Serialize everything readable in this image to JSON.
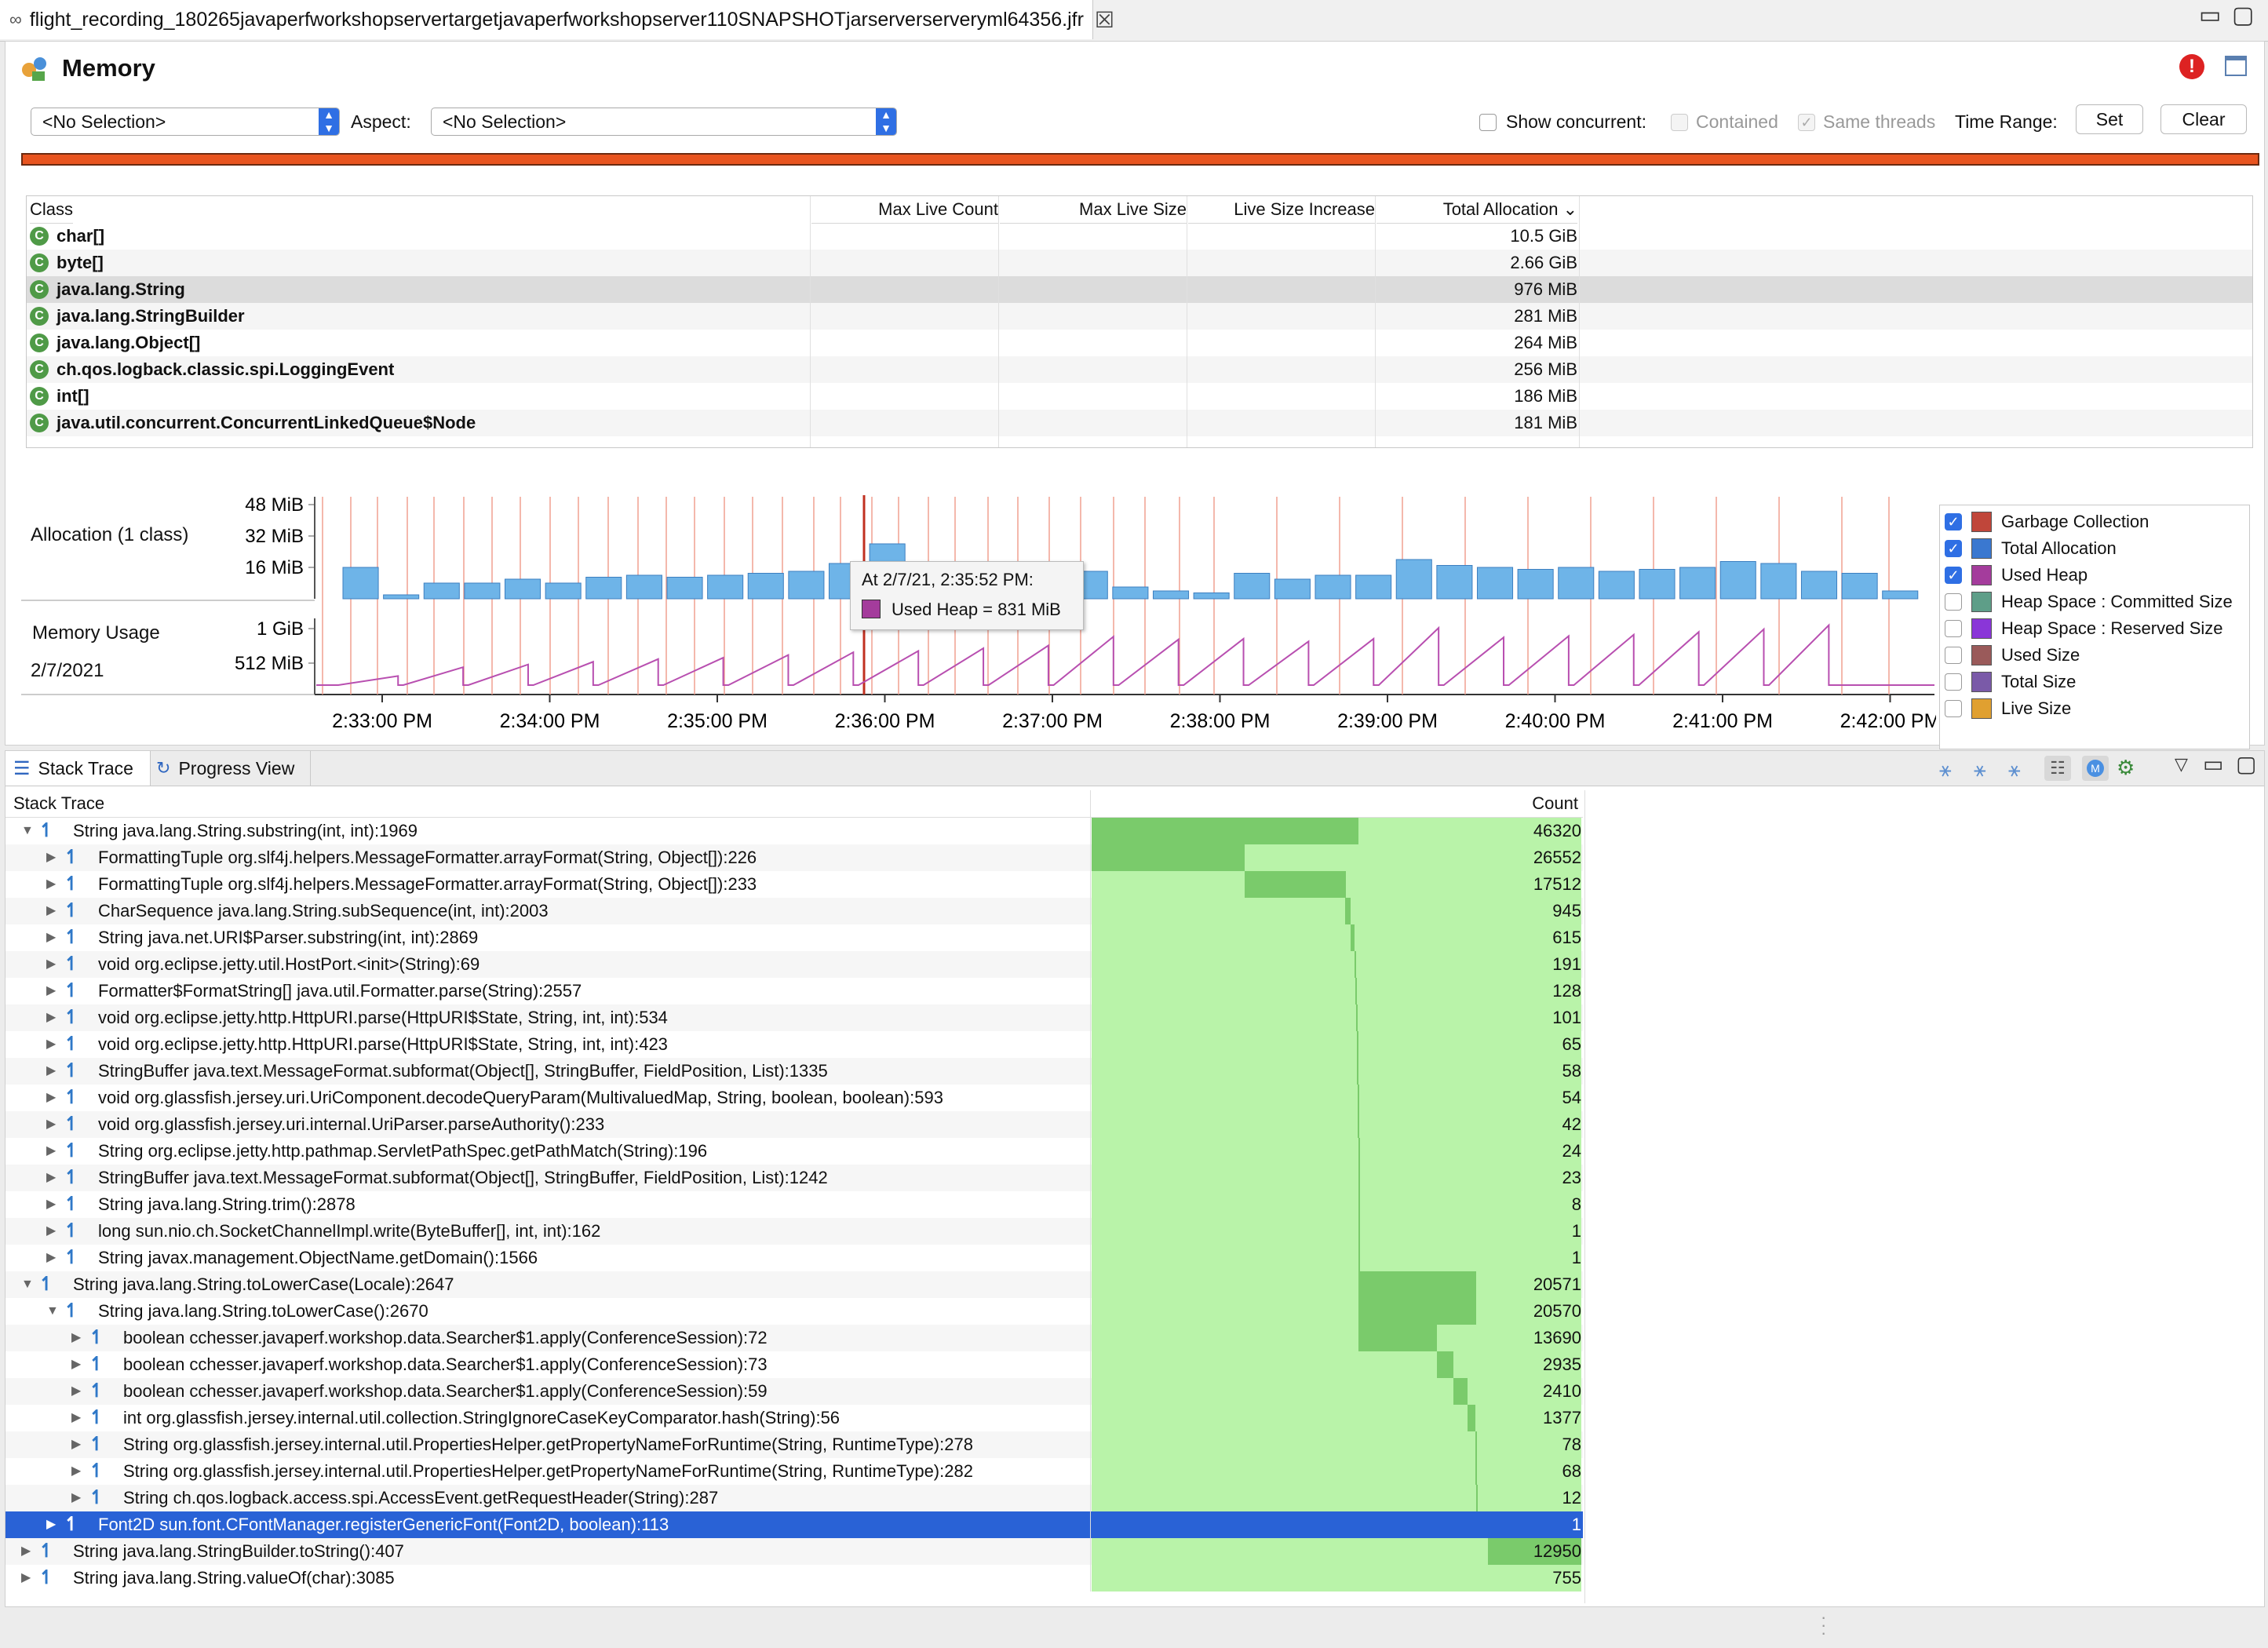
{
  "window": {
    "tab_title": "flight_recording_180265javaperfworkshopservertargetjavaperfworkshopserver110SNAPSHOTjarserverserveryml64356.jfr",
    "tab_icon": "recording-icon",
    "close_glyph": "☒",
    "minimize_glyph": "▭",
    "maximize_glyph": "▢"
  },
  "memory": {
    "title": "Memory",
    "warning_glyph": "!",
    "filter_select": "<No Selection>",
    "aspect_label": "Aspect:",
    "aspect_select": "<No Selection>",
    "show_concurrent_label": "Show concurrent:",
    "contained_label": "Contained",
    "same_threads_label": "Same threads",
    "time_range_label": "Time Range:",
    "set_label": "Set",
    "clear_label": "Clear",
    "progress_color": "#e8541f"
  },
  "class_table": {
    "columns": {
      "class": "Class",
      "max_live_count": "Max Live Count",
      "max_live_size": "Max Live Size",
      "live_size_increase": "Live Size Increase",
      "total_allocation": "Total Allocation"
    },
    "rows": [
      {
        "icon": "C",
        "name": "char[]",
        "total": "10.5 GiB"
      },
      {
        "icon": "C",
        "name": "byte[]",
        "total": "2.66 GiB"
      },
      {
        "icon": "C",
        "name": "java.lang.String",
        "total": "976 MiB"
      },
      {
        "icon": "C",
        "name": "java.lang.StringBuilder",
        "total": "281 MiB"
      },
      {
        "icon": "C",
        "name": "java.lang.Object[]",
        "total": "264 MiB"
      },
      {
        "icon": "C",
        "name": "ch.qos.logback.classic.spi.LoggingEvent",
        "total": "256 MiB"
      },
      {
        "icon": "C",
        "name": "int[]",
        "total": "186 MiB"
      },
      {
        "icon": "C",
        "name": "java.util.concurrent.ConcurrentLinkedQueue$Node",
        "total": "181 MiB"
      }
    ]
  },
  "chart": {
    "alloc_label": "Allocation (1 class)",
    "usage_label": "Memory Usage",
    "date_label": "2/7/2021",
    "alloc_ticks": [
      "48 MiB",
      "32 MiB",
      "16 MiB"
    ],
    "usage_ticks": [
      "1 GiB",
      "512 MiB"
    ],
    "time_ticks": [
      "2:33:00 PM",
      "2:34:00 PM",
      "2:35:00 PM",
      "2:36:00 PM",
      "2:37:00 PM",
      "2:38:00 PM",
      "2:39:00 PM",
      "2:40:00 PM",
      "2:41:00 PM",
      "2:42:00 PM"
    ],
    "tooltip_title": "At 2/7/21, 2:35:52 PM:",
    "tooltip_value": "Used Heap = 831 MiB",
    "bar_color": "#6eb4e8",
    "heap_color": "#b84fb0"
  },
  "chart_data": {
    "type": "bar",
    "alloc_mib": [
      16,
      2,
      8,
      8,
      10,
      8,
      11,
      12,
      11,
      12,
      13,
      14,
      18,
      28,
      14,
      14,
      16,
      13,
      14,
      6,
      4,
      3,
      13,
      10,
      12,
      12,
      20,
      17,
      16,
      15,
      16,
      14,
      15,
      16,
      19,
      18,
      14,
      13,
      4
    ],
    "used_heap_sawtooth_peaks_mib": [
      250,
      380,
      420,
      460,
      500,
      520,
      560,
      600,
      620,
      660,
      700,
      831,
      790,
      800,
      760,
      800,
      960,
      820,
      840,
      860,
      900,
      940,
      1000
    ]
  },
  "legend": [
    {
      "label": "Garbage Collection",
      "checked": true,
      "color": "#c0463a"
    },
    {
      "label": "Total Allocation",
      "checked": true,
      "color": "#3a78d0"
    },
    {
      "label": "Used Heap",
      "checked": true,
      "color": "#a43c9c"
    },
    {
      "label": "Heap Space : Committed Size",
      "checked": false,
      "color": "#5e9e88"
    },
    {
      "label": "Heap Space : Reserved Size",
      "checked": false,
      "color": "#8a36d8"
    },
    {
      "label": "Used Size",
      "checked": false,
      "color": "#9a5a5a"
    },
    {
      "label": "Total Size",
      "checked": false,
      "color": "#7a5aa8"
    },
    {
      "label": "Live Size",
      "checked": false,
      "color": "#e0a030"
    }
  ],
  "bottom_tabs": {
    "stack_trace": "Stack Trace",
    "progress_view": "Progress View"
  },
  "stack_table": {
    "col_stack": "Stack Trace",
    "col_count": "Count",
    "rows": [
      {
        "level": 0,
        "open": true,
        "text": "String java.lang.String.substring(int, int):1969",
        "count": "46320",
        "b": 0,
        "d": 46320
      },
      {
        "level": 1,
        "open": false,
        "text": "FormattingTuple org.slf4j.helpers.MessageFormatter.arrayFormat(String, Object[]):226",
        "count": "26552",
        "b": 0,
        "d": 26552
      },
      {
        "level": 1,
        "open": false,
        "text": "FormattingTuple org.slf4j.helpers.MessageFormatter.arrayFormat(String, Object[]):233",
        "count": "17512",
        "b": 26552,
        "d": 17512
      },
      {
        "level": 1,
        "open": false,
        "text": "CharSequence java.lang.String.subSequence(int, int):2003",
        "count": "945",
        "b": 44064,
        "d": 945
      },
      {
        "level": 1,
        "open": false,
        "text": "String java.net.URI$Parser.substring(int, int):2869",
        "count": "615",
        "b": 45009,
        "d": 615
      },
      {
        "level": 1,
        "open": false,
        "text": "void org.eclipse.jetty.util.HostPort.<init>(String):69",
        "count": "191",
        "b": 45624,
        "d": 191
      },
      {
        "level": 1,
        "open": false,
        "text": "Formatter$FormatString[] java.util.Formatter.parse(String):2557",
        "count": "128",
        "b": 45815,
        "d": 128
      },
      {
        "level": 1,
        "open": false,
        "text": "void org.eclipse.jetty.http.HttpURI.parse(HttpURI$State, String, int, int):534",
        "count": "101",
        "b": 45943,
        "d": 101
      },
      {
        "level": 1,
        "open": false,
        "text": "void org.eclipse.jetty.http.HttpURI.parse(HttpURI$State, String, int, int):423",
        "count": "65",
        "b": 46044,
        "d": 65
      },
      {
        "level": 1,
        "open": false,
        "text": "StringBuffer java.text.MessageFormat.subformat(Object[], StringBuffer, FieldPosition, List):1335",
        "count": "58",
        "b": 46109,
        "d": 58
      },
      {
        "level": 1,
        "open": false,
        "text": "void org.glassfish.jersey.uri.UriComponent.decodeQueryParam(MultivaluedMap, String, boolean, boolean):593",
        "count": "54",
        "b": 46167,
        "d": 54
      },
      {
        "level": 1,
        "open": false,
        "text": "void org.glassfish.jersey.uri.internal.UriParser.parseAuthority():233",
        "count": "42",
        "b": 46221,
        "d": 42
      },
      {
        "level": 1,
        "open": false,
        "text": "String org.eclipse.jetty.http.pathmap.ServletPathSpec.getPathMatch(String):196",
        "count": "24",
        "b": 46263,
        "d": 24
      },
      {
        "level": 1,
        "open": false,
        "text": "StringBuffer java.text.MessageFormat.subformat(Object[], StringBuffer, FieldPosition, List):1242",
        "count": "23",
        "b": 46287,
        "d": 23
      },
      {
        "level": 1,
        "open": false,
        "text": "String java.lang.String.trim():2878",
        "count": "8",
        "b": 46310,
        "d": 8
      },
      {
        "level": 1,
        "open": false,
        "text": "long sun.nio.ch.SocketChannelImpl.write(ByteBuffer[], int, int):162",
        "count": "1",
        "b": 46318,
        "d": 1
      },
      {
        "level": 1,
        "open": false,
        "text": "String javax.management.ObjectName.getDomain():1566",
        "count": "1",
        "b": 46319,
        "d": 1
      },
      {
        "level": 0,
        "open": true,
        "text": "String java.lang.String.toLowerCase(Locale):2647",
        "count": "20571",
        "b": 46320,
        "d": 20571
      },
      {
        "level": 1,
        "open": true,
        "text": "String java.lang.String.toLowerCase():2670",
        "count": "20570",
        "b": 46320,
        "d": 20570
      },
      {
        "level": 2,
        "open": false,
        "text": "boolean cchesser.javaperf.workshop.data.Searcher$1.apply(ConferenceSession):72",
        "count": "13690",
        "b": 46320,
        "d": 13690
      },
      {
        "level": 2,
        "open": false,
        "text": "boolean cchesser.javaperf.workshop.data.Searcher$1.apply(ConferenceSession):73",
        "count": "2935",
        "b": 60010,
        "d": 2935
      },
      {
        "level": 2,
        "open": false,
        "text": "boolean cchesser.javaperf.workshop.data.Searcher$1.apply(ConferenceSession):59",
        "count": "2410",
        "b": 62945,
        "d": 2410
      },
      {
        "level": 2,
        "open": false,
        "text": "int org.glassfish.jersey.internal.util.collection.StringIgnoreCaseKeyComparator.hash(String):56",
        "count": "1377",
        "b": 65355,
        "d": 1377
      },
      {
        "level": 2,
        "open": false,
        "text": "String org.glassfish.jersey.internal.util.PropertiesHelper.getPropertyNameForRuntime(String, RuntimeType):278",
        "count": "78",
        "b": 66732,
        "d": 78
      },
      {
        "level": 2,
        "open": false,
        "text": "String org.glassfish.jersey.internal.util.PropertiesHelper.getPropertyNameForRuntime(String, RuntimeType):282",
        "count": "68",
        "b": 66810,
        "d": 68
      },
      {
        "level": 2,
        "open": false,
        "text": "String ch.qos.logback.access.spi.AccessEvent.getRequestHeader(String):287",
        "count": "12",
        "b": 66878,
        "d": 12
      },
      {
        "level": 1,
        "open": false,
        "text": "Font2D sun.font.CFontManager.registerGenericFont(Font2D, boolean):113",
        "count": "1",
        "b": 66890,
        "d": 1,
        "selected": true
      },
      {
        "level": 0,
        "open": false,
        "text": "String java.lang.StringBuilder.toString():407",
        "count": "12950",
        "b": 66891,
        "d": 12950
      },
      {
        "level": 0,
        "open": false,
        "text": "String java.lang.String.valueOf(char):3085",
        "count": "755",
        "b": 79841,
        "d": 755
      }
    ]
  }
}
